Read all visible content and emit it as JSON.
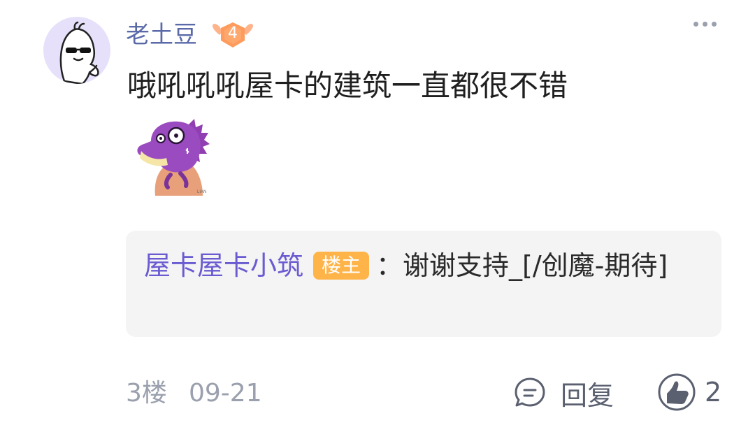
{
  "comment": {
    "username": "老土豆",
    "level": "4",
    "text": "哦吼吼吼屋卡的建筑一直都很不错",
    "avatar_icon": "cool-bean-avatar",
    "sticker_icon": "purple-dinosaur-sticker",
    "sticker_signature": "LIAN"
  },
  "reply": {
    "author": "屋卡屋卡小筑",
    "badge": "楼主",
    "separator": "：",
    "text": "谢谢支持_[/创魔-期待]"
  },
  "footer": {
    "floor": "3楼",
    "date": "09-21",
    "reply_label": "回复",
    "like_count": "2"
  },
  "colors": {
    "username": "#5a6aa8",
    "reply_author": "#6a5bd1",
    "op_badge": "#ffb44a",
    "level_badge": "#ff9b5c",
    "meta_text": "#9aa0ad"
  }
}
